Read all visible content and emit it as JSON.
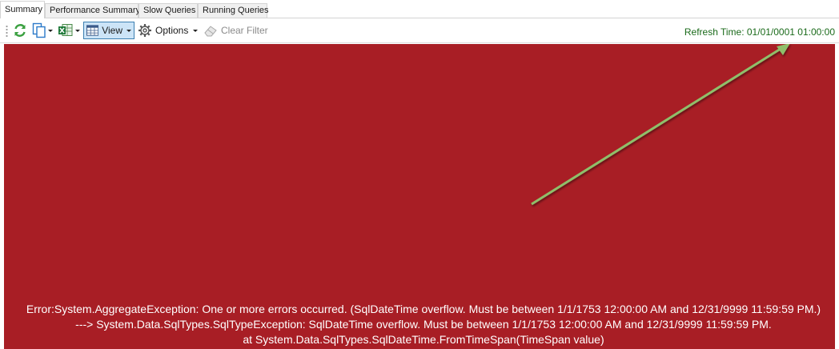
{
  "tabs": [
    {
      "label": "Summary",
      "active": true
    },
    {
      "label": "Performance Summary",
      "active": false
    },
    {
      "label": "Slow Queries",
      "active": false
    },
    {
      "label": "Running Queries",
      "active": false
    }
  ],
  "toolbar": {
    "refresh_icon": "refresh-icon",
    "copy_icon": "copy-icon",
    "excel_icon": "excel-export-icon",
    "view_label": "View",
    "options_label": "Options",
    "clear_filter_label": "Clear Filter",
    "refresh_time": "Refresh Time: 01/01/0001 01:00:00"
  },
  "error": {
    "background_color": "#a81e25",
    "line1": "Error:System.AggregateException: One or more errors occurred. (SqlDateTime overflow. Must be between 1/1/1753 12:00:00 AM and 12/31/9999 11:59:59 PM.)",
    "line2": "---> System.Data.SqlTypes.SqlTypeException: SqlDateTime overflow. Must be between 1/1/1753 12:00:00 AM and 12/31/9999 11:59:59 PM.",
    "line3": "at System.Data.SqlTypes.SqlDateTime.FromTimeSpan(TimeSpan value)"
  },
  "annotation": {
    "arrow_color": "#8fbf6a"
  }
}
